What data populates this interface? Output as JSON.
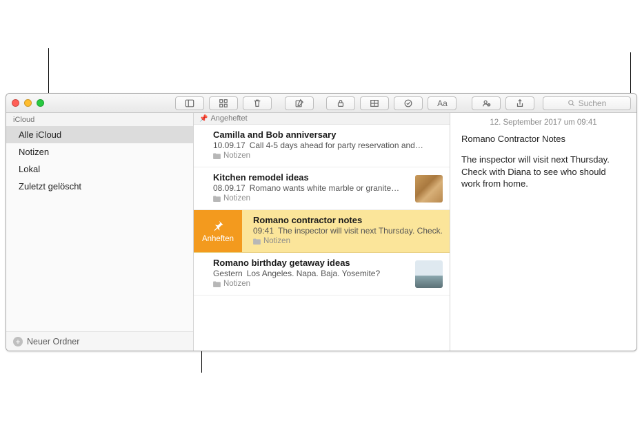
{
  "toolbar": {
    "search_placeholder": "Suchen"
  },
  "sidebar": {
    "account": "iCloud",
    "items": [
      "Alle iCloud",
      "Notizen",
      "Lokal",
      "Zuletzt gelöscht"
    ],
    "new_folder": "Neuer Ordner"
  },
  "notelist": {
    "pinned_header": "Angeheftet",
    "pin_action": "Anheften",
    "items": [
      {
        "title": "Camilla and Bob anniversary",
        "date": "10.09.17",
        "preview": "Call 4-5 days ahead for party reservation and…",
        "folder": "Notizen",
        "thumb": null
      },
      {
        "title": "Kitchen remodel ideas",
        "date": "08.09.17",
        "preview": "Romano wants white marble or granite…",
        "folder": "Notizen",
        "thumb": "wood"
      },
      {
        "title": "Romano contractor notes",
        "date": "09:41",
        "preview": "The inspector will visit next Thursday. Check.",
        "folder": "Notizen",
        "thumb": null,
        "selected": true,
        "show_pin_action": true
      },
      {
        "title": "Romano birthday getaway ideas",
        "date": "Gestern",
        "preview": "Los Angeles. Napa. Baja. Yosemite?",
        "folder": "Notizen",
        "thumb": "beach"
      }
    ]
  },
  "detail": {
    "date": "12. September 2017 um 09:41",
    "title": "Romano Contractor Notes",
    "body": "The inspector will visit next Thursday. Check with Diana to see who should work from home."
  }
}
